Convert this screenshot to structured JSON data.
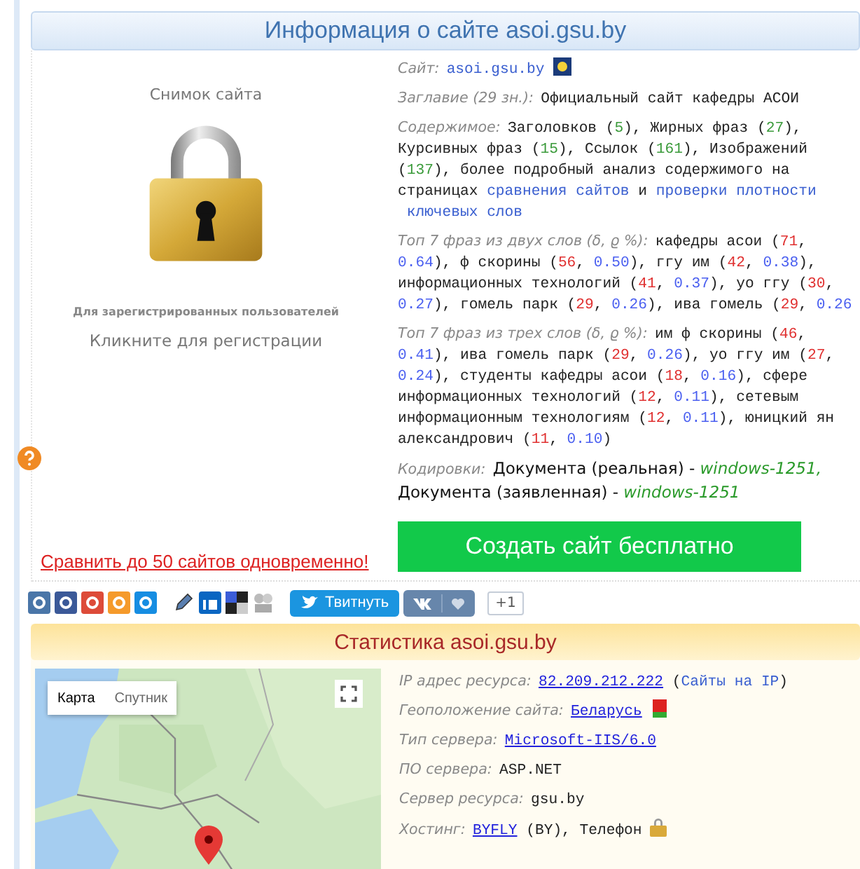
{
  "header": {
    "title": "Информация о сайте asoi.gsu.by"
  },
  "snapshot": {
    "title": "Снимок сайта",
    "note": "Для зарегистрированных пользователей",
    "link": "Кликните для регистрации"
  },
  "compare_link": "Сравнить до 50 сайтов одновременно!",
  "info": [
    {
      "label": "Сайт:",
      "segments": [
        {
          "kind": "link",
          "text": "asoi.gsu.by"
        },
        {
          "kind": "favicon"
        }
      ]
    },
    {
      "label": "Заглавие (29 зн.):",
      "segments": [
        {
          "kind": "text",
          "text": "Официальный сайт кафедры АСОИ"
        }
      ]
    },
    {
      "label": "Содержимое:",
      "segments": [
        {
          "kind": "text",
          "text": "Заголовков ("
        },
        {
          "kind": "count",
          "text": "5"
        },
        {
          "kind": "text",
          "text": "), Жирных фраз ("
        },
        {
          "kind": "count",
          "text": "27"
        },
        {
          "kind": "text",
          "text": "), Курсивных фраз ("
        },
        {
          "kind": "count",
          "text": "15"
        },
        {
          "kind": "text",
          "text": "), Ссылок ("
        },
        {
          "kind": "count",
          "text": "161"
        },
        {
          "kind": "text",
          "text": "), Изображений ("
        },
        {
          "kind": "count",
          "text": "137"
        },
        {
          "kind": "text",
          "text": "), более подробный анализ содержимого на страницах "
        },
        {
          "kind": "link",
          "text": "сравнения сайтов"
        },
        {
          "kind": "text",
          "text": " и "
        },
        {
          "kind": "link",
          "text": "проверки плотности"
        },
        {
          "kind": "link",
          "text": "ключевых слов"
        }
      ]
    },
    {
      "label": "Топ 7 фраз из двух слов (δ, ϱ %):",
      "segments": [
        {
          "kind": "text",
          "text": "кафедры асои ("
        },
        {
          "kind": "freq",
          "text": "71"
        },
        {
          "kind": "text",
          "text": ", "
        },
        {
          "kind": "density",
          "text": "0.64"
        },
        {
          "kind": "text",
          "text": "), ф скорины ("
        },
        {
          "kind": "freq",
          "text": "56"
        },
        {
          "kind": "text",
          "text": ", "
        },
        {
          "kind": "density",
          "text": "0.50"
        },
        {
          "kind": "text",
          "text": "), ггу им ("
        },
        {
          "kind": "freq",
          "text": "42"
        },
        {
          "kind": "text",
          "text": ", "
        },
        {
          "kind": "density",
          "text": "0.38"
        },
        {
          "kind": "text",
          "text": "), информационных технологий ("
        },
        {
          "kind": "freq",
          "text": "41"
        },
        {
          "kind": "text",
          "text": ", "
        },
        {
          "kind": "density",
          "text": "0.37"
        },
        {
          "kind": "text",
          "text": "), уо ггу ("
        },
        {
          "kind": "freq",
          "text": "30"
        },
        {
          "kind": "text",
          "text": ", "
        },
        {
          "kind": "density",
          "text": "0.27"
        },
        {
          "kind": "text",
          "text": "), гомель парк ("
        },
        {
          "kind": "freq",
          "text": "29"
        },
        {
          "kind": "text",
          "text": ", "
        },
        {
          "kind": "density",
          "text": "0.26"
        },
        {
          "kind": "text",
          "text": "), ива гомель ("
        },
        {
          "kind": "freq",
          "text": "29"
        },
        {
          "kind": "text",
          "text": ", "
        },
        {
          "kind": "density",
          "text": "0.26"
        }
      ]
    },
    {
      "label": "Топ 7 фраз из трех слов (δ, ϱ %):",
      "segments": [
        {
          "kind": "text",
          "text": "им ф скорины ("
        },
        {
          "kind": "freq",
          "text": "46"
        },
        {
          "kind": "text",
          "text": ", "
        },
        {
          "kind": "density",
          "text": "0.41"
        },
        {
          "kind": "text",
          "text": "), ива гомель парк ("
        },
        {
          "kind": "freq",
          "text": "29"
        },
        {
          "kind": "text",
          "text": ", "
        },
        {
          "kind": "density",
          "text": "0.26"
        },
        {
          "kind": "text",
          "text": "), уо ггу им ("
        },
        {
          "kind": "freq",
          "text": "27"
        },
        {
          "kind": "text",
          "text": ", "
        },
        {
          "kind": "density",
          "text": "0.24"
        },
        {
          "kind": "text",
          "text": "), студенты кафедры асои ("
        },
        {
          "kind": "freq",
          "text": "18"
        },
        {
          "kind": "text",
          "text": ", "
        },
        {
          "kind": "density",
          "text": "0.16"
        },
        {
          "kind": "text",
          "text": "), сфере информационных технологий ("
        },
        {
          "kind": "freq",
          "text": "12"
        },
        {
          "kind": "text",
          "text": ", "
        },
        {
          "kind": "density",
          "text": "0.11"
        },
        {
          "kind": "text",
          "text": "), сетевым информационным технологиям ("
        },
        {
          "kind": "freq",
          "text": "12"
        },
        {
          "kind": "text",
          "text": ", "
        },
        {
          "kind": "density",
          "text": "0.11"
        },
        {
          "kind": "text",
          "text": "), юницкий ян александрович ("
        },
        {
          "kind": "freq",
          "text": "11"
        },
        {
          "kind": "text",
          "text": ", "
        },
        {
          "kind": "density",
          "text": "0.10"
        },
        {
          "kind": "text",
          "text": ")"
        }
      ]
    },
    {
      "label": "Кодировки:",
      "segments": [
        {
          "kind": "value",
          "text": "Документа (реальная) - "
        },
        {
          "kind": "encoding",
          "text": "windows-1251,"
        },
        {
          "kind": "value",
          "text": " Документа (заявленная) - "
        },
        {
          "kind": "encoding",
          "text": "windows-1251"
        }
      ]
    }
  ],
  "create_button": "Создать сайт бесплатно",
  "share": {
    "tweet": "Твитнуть",
    "count": "+1"
  },
  "stats": {
    "title": "Статистика asoi.gsu.by",
    "map": {
      "tabs": [
        {
          "label": "Карта",
          "selected": true
        },
        {
          "label": "Спутник",
          "selected": false
        }
      ]
    },
    "rows": [
      {
        "label": "IP адрес ресурса:",
        "segments": [
          {
            "kind": "ulink",
            "text": "82.209.212.222"
          },
          {
            "kind": "text",
            "text": " ("
          },
          {
            "kind": "link",
            "text": "Сайты на IP"
          },
          {
            "kind": "text",
            "text": ")"
          }
        ]
      },
      {
        "label": "Геоположение сайта:",
        "segments": [
          {
            "kind": "ulink",
            "text": "Беларусь"
          },
          {
            "kind": "flag"
          }
        ]
      },
      {
        "label": "Тип сервера:",
        "segments": [
          {
            "kind": "ulink",
            "text": "Microsoft-IIS/6.0"
          }
        ]
      },
      {
        "label": "ПО сервера:",
        "segments": [
          {
            "kind": "text",
            "text": "ASP.NET"
          }
        ]
      },
      {
        "label": "Сервер ресурса:",
        "segments": [
          {
            "kind": "text",
            "text": "gsu.by"
          }
        ]
      },
      {
        "label": "Хостинг:",
        "segments": [
          {
            "kind": "ulink",
            "text": "BYFLY"
          },
          {
            "kind": "text",
            "text": " (BY), Телефон"
          },
          {
            "kind": "lock"
          }
        ]
      }
    ]
  }
}
